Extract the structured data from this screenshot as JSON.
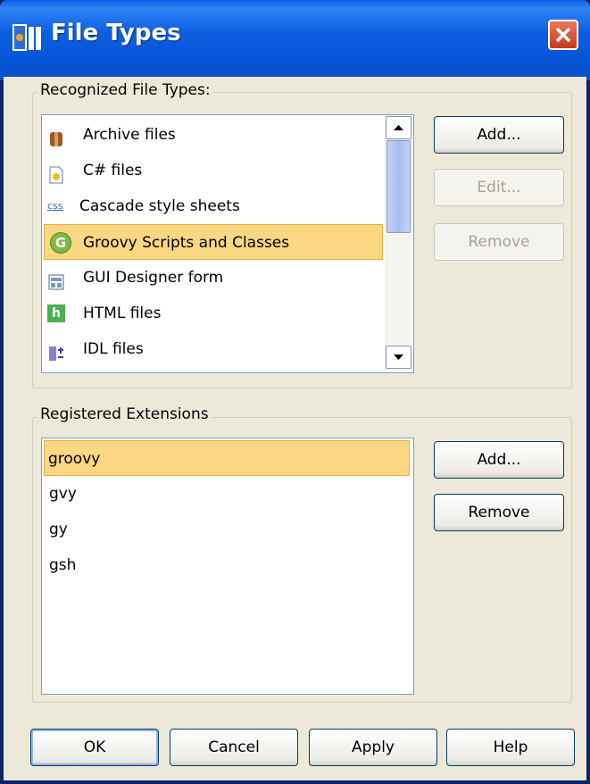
{
  "window": {
    "title": "File Types"
  },
  "recognized": {
    "group_label": "Recognized File Types:",
    "items": [
      {
        "label": "Archive files",
        "icon": "archive-icon"
      },
      {
        "label": "C# files",
        "icon": "csharp-file-icon"
      },
      {
        "label": "Cascade style sheets",
        "icon": "css-icon",
        "icon_text": "css"
      },
      {
        "label": "Groovy Scripts and Classes",
        "icon": "groovy-icon",
        "icon_text": "G",
        "selected": true
      },
      {
        "label": "GUI Designer form",
        "icon": "gui-form-icon"
      },
      {
        "label": "HTML files",
        "icon": "html-icon",
        "icon_text": "h"
      },
      {
        "label": "IDL files",
        "icon": "idl-icon"
      }
    ],
    "buttons": {
      "add": "Add...",
      "edit": "Edit...",
      "remove": "Remove"
    }
  },
  "extensions": {
    "group_label": "Registered Extensions",
    "items": [
      "groovy",
      "gvy",
      "gy",
      "gsh"
    ],
    "buttons": {
      "add": "Add...",
      "remove": "Remove"
    }
  },
  "footer": {
    "ok": "OK",
    "cancel": "Cancel",
    "apply": "Apply",
    "help": "Help"
  },
  "colors": {
    "selection": "#fbd683",
    "title_bar": "#0553d6",
    "close": "#c8391c"
  }
}
